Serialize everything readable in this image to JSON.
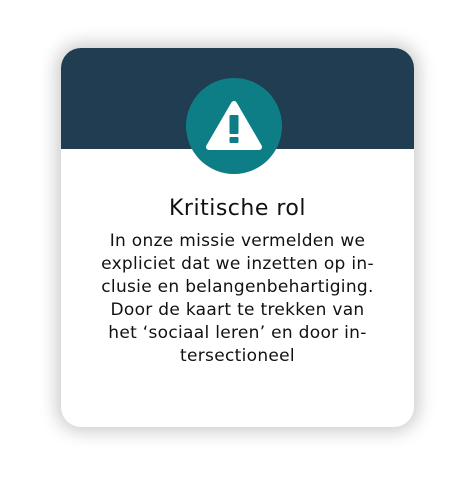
{
  "card": {
    "header_color": "#213d52",
    "icon": {
      "name": "warning-icon",
      "circle_color": "#0e7e86"
    },
    "title": "Kritische rol",
    "body_lines": [
      "In onze missie vermelden we",
      "expliciet dat we inzetten op in-",
      "clusie en belangenbehartiging.",
      "Door de kaart te trekken van",
      "het ‘sociaal leren’ en door in-",
      "tersectioneel"
    ]
  }
}
